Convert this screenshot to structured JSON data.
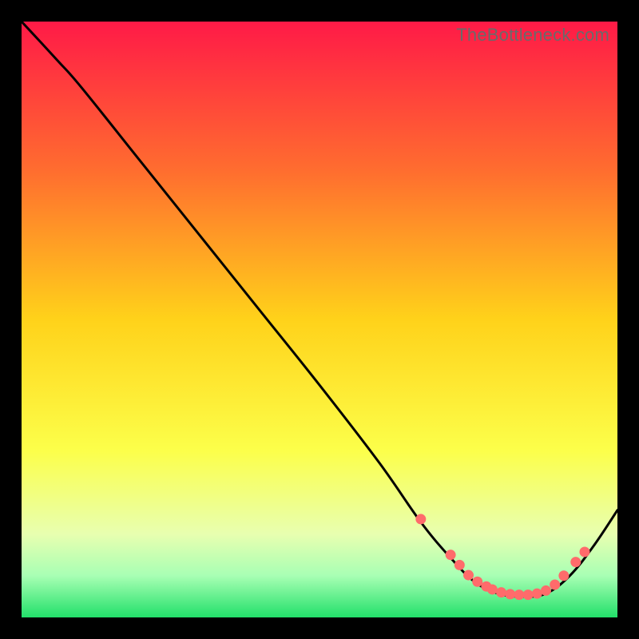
{
  "watermark": "TheBottleneck.com",
  "chart_data": {
    "type": "line",
    "title": "",
    "xlabel": "",
    "ylabel": "",
    "xlim": [
      0,
      100
    ],
    "ylim": [
      0,
      100
    ],
    "grid": false,
    "legend": false,
    "gradient_stops": [
      {
        "offset": 0,
        "color": "#ff1a47"
      },
      {
        "offset": 25,
        "color": "#ff6d2f"
      },
      {
        "offset": 50,
        "color": "#ffd21a"
      },
      {
        "offset": 72,
        "color": "#fcff4a"
      },
      {
        "offset": 86,
        "color": "#e8ffb0"
      },
      {
        "offset": 93,
        "color": "#a8ffb4"
      },
      {
        "offset": 100,
        "color": "#22e06a"
      }
    ],
    "curve": {
      "x": [
        0,
        6,
        10,
        20,
        30,
        40,
        50,
        60,
        67,
        72,
        76,
        80,
        84,
        88,
        92,
        96,
        100
      ],
      "y": [
        100,
        93.5,
        89,
        76.5,
        64,
        51.5,
        39,
        26,
        16,
        10,
        6,
        4,
        3.5,
        4,
        7,
        12,
        18
      ]
    },
    "markers": {
      "x": [
        67,
        72,
        73.5,
        75,
        76.5,
        78,
        79,
        80.5,
        82,
        83.5,
        85,
        86.5,
        88,
        89.5,
        91,
        93,
        94.5
      ],
      "y": [
        16.5,
        10.5,
        8.8,
        7.1,
        6.0,
        5.2,
        4.7,
        4.2,
        3.9,
        3.8,
        3.8,
        4.0,
        4.5,
        5.5,
        7.0,
        9.3,
        11.0
      ],
      "color": "#ff6b6b",
      "radius": 6.5
    }
  }
}
